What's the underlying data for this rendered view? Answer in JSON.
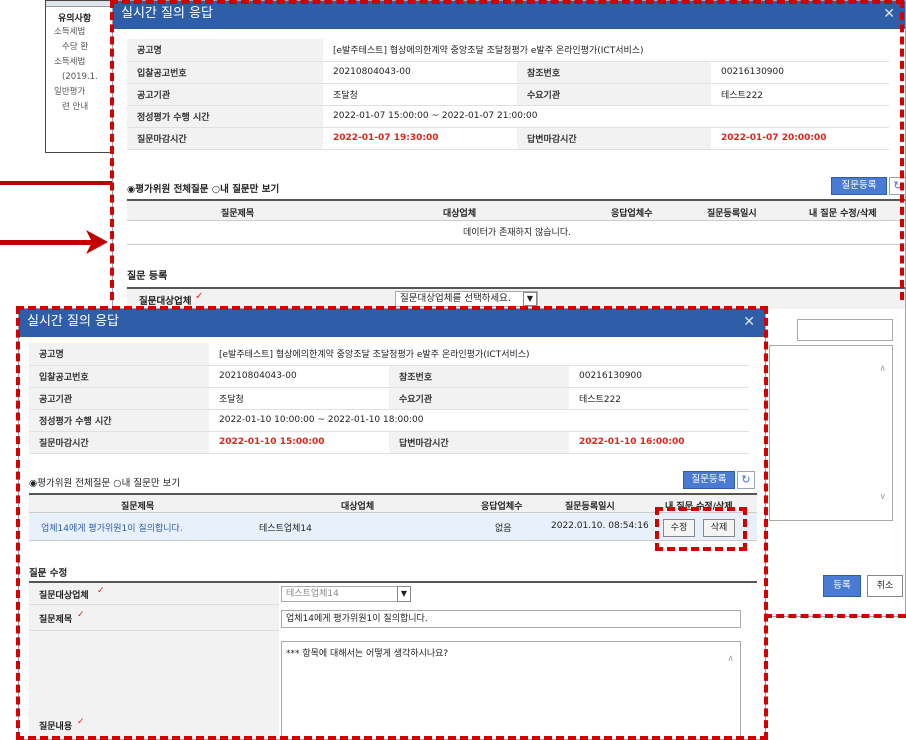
{
  "bg_notice": {
    "title": "유의사항",
    "lines": [
      "소득세법",
      "수당 환",
      "소득세법",
      "(2019.1.",
      "일반평가",
      "련 안내"
    ]
  },
  "dialog_top": {
    "title": "실시간 질의 응답",
    "rows": {
      "notice_name_label": "공고명",
      "notice_name_value": "[e발주테스트] 협상에의한계약 중앙조달 조달청평가 e발주 온라인평가(ICT서비스)",
      "bid_no_label": "입찰공고번호",
      "bid_no_value": "20210804043-00",
      "ref_no_label": "참조번호",
      "ref_no_value": "00216130900",
      "agency_label": "공고기관",
      "agency_value": "조달청",
      "demand_label": "수요기관",
      "demand_value": "테스트222",
      "eval_time_label": "정성평가 수행 시간",
      "eval_time_value": "2022-01-07 15:00:00 ~ 2022-01-07 21:00:00",
      "q_deadline_label": "질문마감시간",
      "q_deadline_value": "2022-01-07 19:30:00",
      "a_deadline_label": "답변마감시간",
      "a_deadline_value": "2022-01-07 20:00:00"
    },
    "filter_all": "평가위원 전체질문",
    "filter_mine": "내 질문만 보기",
    "register_question": "질문등록",
    "columns": [
      "질문제목",
      "대상업체",
      "응답업체수",
      "질문등록일시",
      "내 질문 수정/삭제"
    ],
    "empty_text": "데이터가 존재하지 않습니다.",
    "section_register": "질문 등록",
    "target_label": "질문대상업체",
    "target_placeholder": "질문대상업체를 선택하세요.",
    "btn_register": "등록",
    "btn_cancel": "취소"
  },
  "dialog_bottom": {
    "title": "실시간 질의 응답",
    "rows": {
      "notice_name_label": "공고명",
      "notice_name_value": "[e발주테스트] 협상에의한계약 중앙조달 조달청평가 e발주 온라인평가(ICT서비스)",
      "bid_no_label": "입찰공고번호",
      "bid_no_value": "20210804043-00",
      "ref_no_label": "참조번호",
      "ref_no_value": "00216130900",
      "agency_label": "공고기관",
      "agency_value": "조달청",
      "demand_label": "수요기관",
      "demand_value": "테스트222",
      "eval_time_label": "정성평가 수행 시간",
      "eval_time_value": "2022-01-10 10:00:00 ~ 2022-01-10 18:00:00",
      "q_deadline_label": "질문마감시간",
      "q_deadline_value": "2022-01-10 15:00:00",
      "a_deadline_label": "답변마감시간",
      "a_deadline_value": "2022-01-10 16:00:00"
    },
    "filter_all": "평가위원 전체질문",
    "filter_mine": "내 질문만 보기",
    "register_question": "질문등록",
    "columns": [
      "질문제목",
      "대상업체",
      "응답업체수",
      "질문등록일시",
      "내 질문 수정/삭제"
    ],
    "row": {
      "title": "업체14에게 평가위원1이 질의합니다.",
      "target": "테스트업체14",
      "responses": "없음",
      "registered": "2022.01.10. 08:54:16",
      "edit": "수정",
      "delete": "삭제"
    },
    "section_edit": "질문 수정",
    "target_label": "질문대상업체",
    "target_value": "테스트업체14",
    "subject_label": "질문제목",
    "subject_value": "업체14에게 평가위원1이 질의합니다.",
    "content_label": "질문내용",
    "content_value": "*** 항목에 대해서는 어떻게 생각하시나요?"
  }
}
